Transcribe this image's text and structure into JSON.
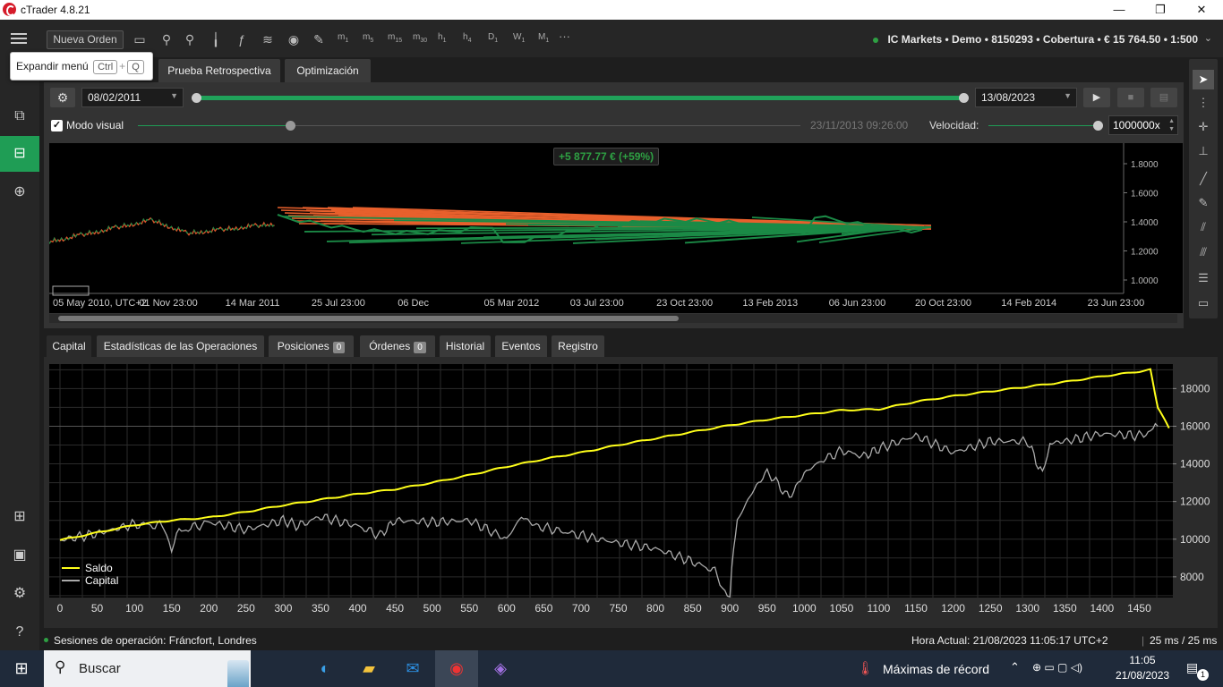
{
  "app": {
    "title": "cTrader 4.8.21"
  },
  "window_controls": {
    "minimize": "—",
    "maximize": "❐",
    "close": "✕"
  },
  "toolbar": {
    "new_order": "Nueva Orden",
    "timeframes": [
      {
        "l": "m",
        "s": "1"
      },
      {
        "l": "m",
        "s": "5"
      },
      {
        "l": "m",
        "s": "15"
      },
      {
        "l": "m",
        "s": "30"
      },
      {
        "l": "h",
        "s": "1"
      },
      {
        "l": "h",
        "s": "4"
      },
      {
        "l": "D",
        "s": "1"
      },
      {
        "l": "W",
        "s": "1"
      },
      {
        "l": "M",
        "s": "1"
      }
    ],
    "more": "···"
  },
  "account": {
    "text": "IC Markets • Demo • 8150293 • Cobertura • € 15 764.50 • 1:500"
  },
  "tooltip": {
    "label": "Expandir menú",
    "key1": "Ctrl",
    "plus": "+",
    "key2": "Q"
  },
  "tabs_top": [
    "Prueba Retrospectiva",
    "Optimización"
  ],
  "backtest": {
    "start_date": "08/02/2011",
    "end_date": "13/08/2023",
    "visual_mode": "Modo visual",
    "visual_mode_checked": true,
    "current_time": "23/11/2013 09:26:00",
    "speed_label": "Velocidad:",
    "speed_value": "1000000x",
    "pnl": "+5 877.77 € (+59%)"
  },
  "price_chart": {
    "y_ticks": [
      "1.8000",
      "1.6000",
      "1.4000",
      "1.2000",
      "1.0000"
    ],
    "x_ticks": [
      "05 May 2010, UTC+2",
      "01 Nov 23:00",
      "14 Mar 2011",
      "25 Jul 23:00",
      "06 Dec",
      "05 Mar 2012",
      "03 Jul 23:00",
      "23 Oct 23:00",
      "13 Feb 2013",
      "06 Jun 23:00",
      "20 Oct 23:00",
      "14 Feb 2014",
      "23 Jun 23:00"
    ]
  },
  "tabs_bottom": [
    {
      "label": "Capital",
      "badge": ""
    },
    {
      "label": "Estadísticas de las Operaciones",
      "badge": ""
    },
    {
      "label": "Posiciones",
      "badge": "0"
    },
    {
      "label": "Órdenes",
      "badge": "0"
    },
    {
      "label": "Historial",
      "badge": ""
    },
    {
      "label": "Eventos",
      "badge": ""
    },
    {
      "label": "Registro",
      "badge": ""
    }
  ],
  "chart_data": {
    "type": "line",
    "xlim": [
      0,
      1500
    ],
    "ylim": [
      6900,
      19300
    ],
    "x_ticks": [
      0,
      50,
      100,
      150,
      200,
      250,
      300,
      350,
      400,
      450,
      500,
      550,
      600,
      650,
      700,
      750,
      800,
      850,
      900,
      950,
      1000,
      1050,
      1100,
      1150,
      1200,
      1250,
      1300,
      1350,
      1400,
      1450
    ],
    "y_ticks": [
      8000,
      10000,
      12000,
      14000,
      16000,
      18000
    ],
    "grid": true,
    "legend_position": "bottom-left",
    "series": [
      {
        "name": "Saldo",
        "color": "#ffff1a",
        "x": [
          0,
          50,
          100,
          150,
          200,
          250,
          300,
          350,
          400,
          450,
          500,
          550,
          600,
          650,
          700,
          750,
          800,
          850,
          900,
          950,
          1000,
          1050,
          1100,
          1150,
          1200,
          1250,
          1300,
          1350,
          1400,
          1450,
          1465,
          1475,
          1490
        ],
        "y": [
          9950,
          10350,
          10750,
          11000,
          11150,
          11450,
          11800,
          12100,
          12400,
          12650,
          13000,
          13400,
          13850,
          14250,
          14600,
          15000,
          15350,
          15700,
          16050,
          16350,
          16600,
          16850,
          16900,
          17300,
          17600,
          17850,
          18100,
          18350,
          18650,
          18900,
          19000,
          17000,
          15900
        ]
      },
      {
        "name": "Capital",
        "color": "#aaaaaa",
        "x": [
          0,
          50,
          100,
          140,
          150,
          160,
          200,
          250,
          300,
          320,
          350,
          400,
          430,
          450,
          500,
          550,
          600,
          620,
          640,
          700,
          750,
          800,
          850,
          880,
          890,
          900,
          905,
          910,
          930,
          950,
          980,
          1000,
          1020,
          1050,
          1080,
          1100,
          1150,
          1200,
          1250,
          1300,
          1320,
          1330,
          1350,
          1400,
          1450,
          1465,
          1475
        ],
        "y": [
          9950,
          10300,
          10800,
          10700,
          9500,
          10400,
          10900,
          10500,
          11000,
          10700,
          11200,
          10700,
          10200,
          11000,
          10900,
          11000,
          10000,
          11200,
          10700,
          10200,
          9800,
          9500,
          8800,
          8300,
          7500,
          7000,
          9500,
          11000,
          12500,
          13600,
          12200,
          13500,
          14100,
          14700,
          14400,
          14800,
          15500,
          14600,
          15200,
          15200,
          13400,
          15100,
          15200,
          15600,
          15500,
          15700,
          16000
        ]
      }
    ]
  },
  "status": {
    "sessions": "Sesiones de operación: Fráncfort, Londres",
    "clock": "Hora Actual:  21/08/2023 11:05:17   UTC+2",
    "latency": "25 ms / 25 ms"
  },
  "taskbar": {
    "search": "Buscar",
    "weather": "Máximas de récord",
    "time": "11:05",
    "date": "21/08/2023",
    "notif": "1"
  }
}
